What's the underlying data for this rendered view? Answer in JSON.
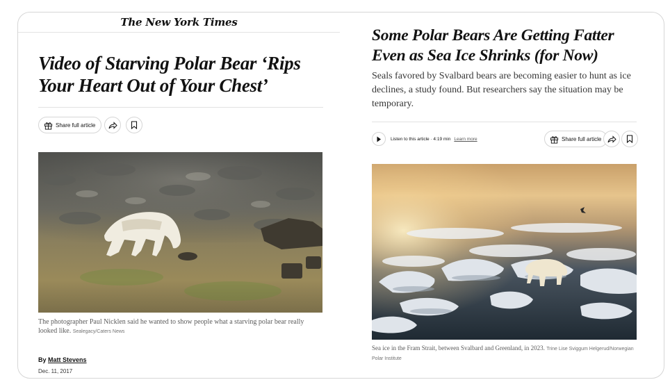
{
  "left_article": {
    "masthead": "The New York Times",
    "title": "Video of Starving Polar Bear ‘Rips Your Heart Out of Your Chest’",
    "share_label": "Share full article",
    "caption": "The photographer Paul Nicklen said he wanted to show people what a starving polar bear really looked like.",
    "credit": "Sealegacy/Caters News",
    "byline_prefix": "By",
    "author": "Matt Stevens",
    "date": "Dec. 11, 2017"
  },
  "right_article": {
    "title": "Some Polar Bears Are Getting Fatter Even as Sea Ice Shrinks (for Now)",
    "summary": "Seals favored by Svalbard bears are becoming easier to hunt as ice declines, a study found. But researchers say the situation may be temporary.",
    "listen_label": "Listen to this article · 4:19 min",
    "learn_more": "Learn more",
    "share_label": "Share full article",
    "caption": "Sea ice in the Fram Strait, between Svalbard and Greenland, in 2023.",
    "credit": "Trine Lise Sviggum Helgerud/Norwegian Polar Institute"
  },
  "icons": [
    "gift-icon",
    "share-icon",
    "bookmark-icon",
    "play-icon"
  ]
}
